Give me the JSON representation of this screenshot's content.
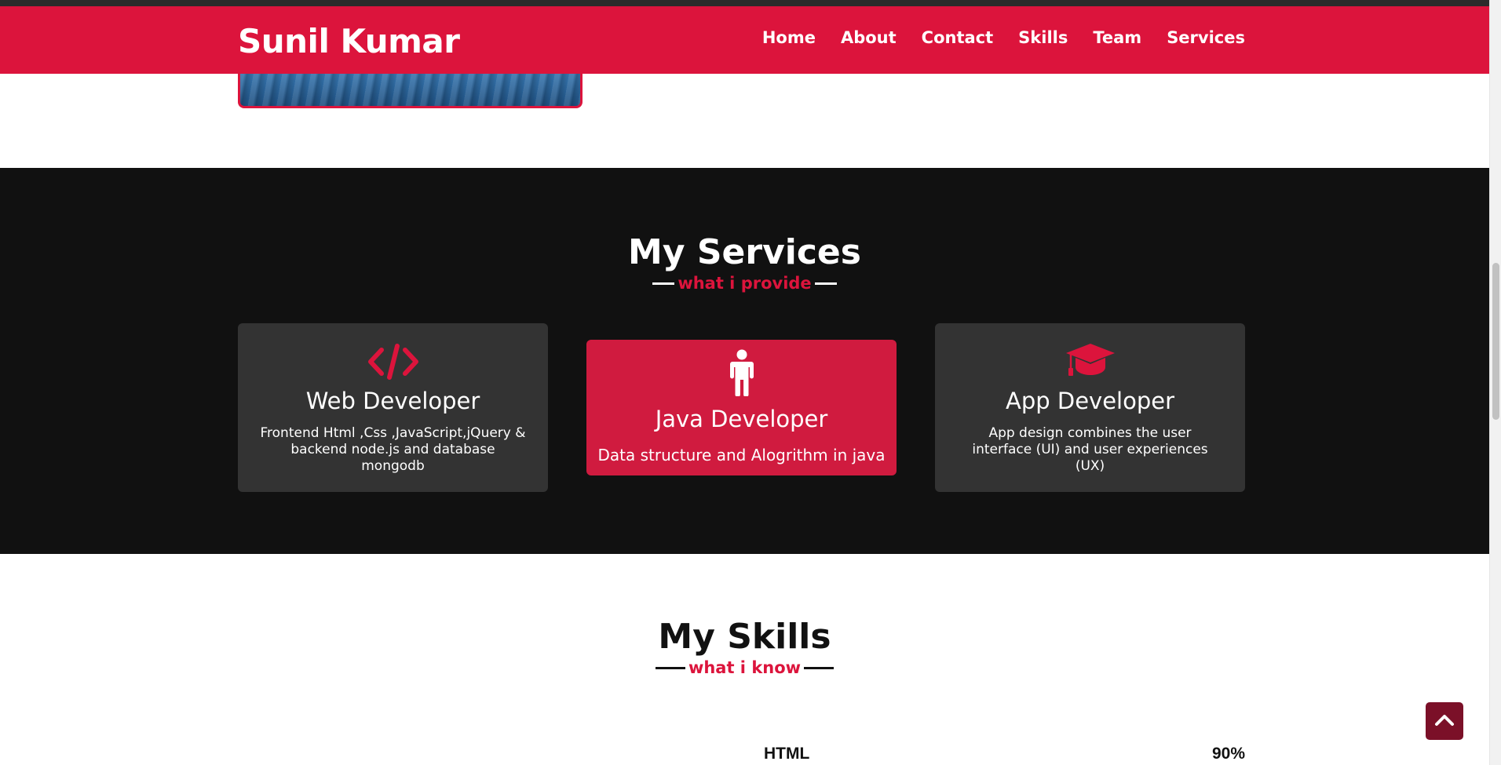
{
  "navbar": {
    "brand": "Sunil Kumar",
    "links": [
      "Home",
      "About",
      "Contact",
      "Skills",
      "Team",
      "Services"
    ]
  },
  "services": {
    "title": "My Services",
    "subtitle": "what i provide",
    "cards": [
      {
        "icon": "code-icon",
        "title": "Web Developer",
        "description": "Frontend Html ,Css ,JavaScript,jQuery & backend node.js and database mongodb"
      },
      {
        "icon": "person-icon",
        "title": "Java Developer",
        "description": "Data structure and Alogrithm in java"
      },
      {
        "icon": "graduation-cap-icon",
        "title": "App Developer",
        "description": "App design combines the user interface (UI) and user experiences (UX)"
      }
    ]
  },
  "skills": {
    "title": "My Skills",
    "subtitle": "what i know",
    "items": [
      {
        "name": "HTML",
        "percent": "90%"
      }
    ]
  },
  "colors": {
    "accent": "#dc143c",
    "dark_bg": "#111111",
    "card_bg": "#333333",
    "scroll_top_bg": "#7b1028"
  }
}
